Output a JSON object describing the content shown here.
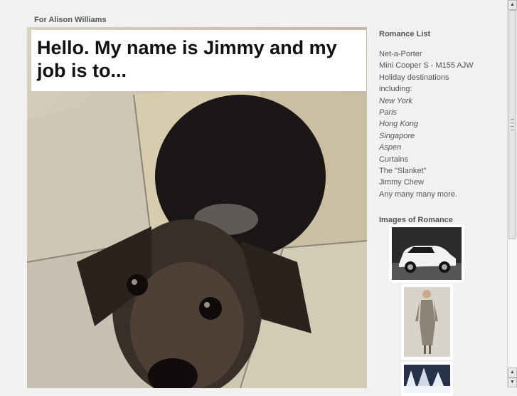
{
  "site": {
    "header": "For Alison Williams"
  },
  "post": {
    "title": "Hello. My name is Jimmy and my job is to..."
  },
  "sidebar": {
    "romance_title": "Romance List",
    "items": [
      {
        "text": "Net-a-Porter",
        "italic": false
      },
      {
        "text": "Mini Cooper S - M155 AJW",
        "italic": false
      },
      {
        "text": "Holiday destinations",
        "italic": false
      },
      {
        "text": "including:",
        "italic": false
      },
      {
        "text": "New York",
        "italic": true
      },
      {
        "text": "Paris",
        "italic": true
      },
      {
        "text": "Hong Kong",
        "italic": true
      },
      {
        "text": "Singapore",
        "italic": true
      },
      {
        "text": "Aspen",
        "italic": true
      },
      {
        "text": "Curtains",
        "italic": false
      },
      {
        "text": "The \"Slanket\"",
        "italic": false
      },
      {
        "text": "Jimmy Chew",
        "italic": false
      },
      {
        "text": "Any many many more.",
        "italic": false
      }
    ],
    "images_title": "Images of Romance",
    "images": [
      {
        "icon": "car-photo-icon"
      },
      {
        "icon": "fashion-model-photo-icon"
      },
      {
        "icon": "snowy-forest-photo-icon"
      }
    ]
  },
  "scrollbar": {
    "up_icon": "▲",
    "down_icon": "▼"
  }
}
